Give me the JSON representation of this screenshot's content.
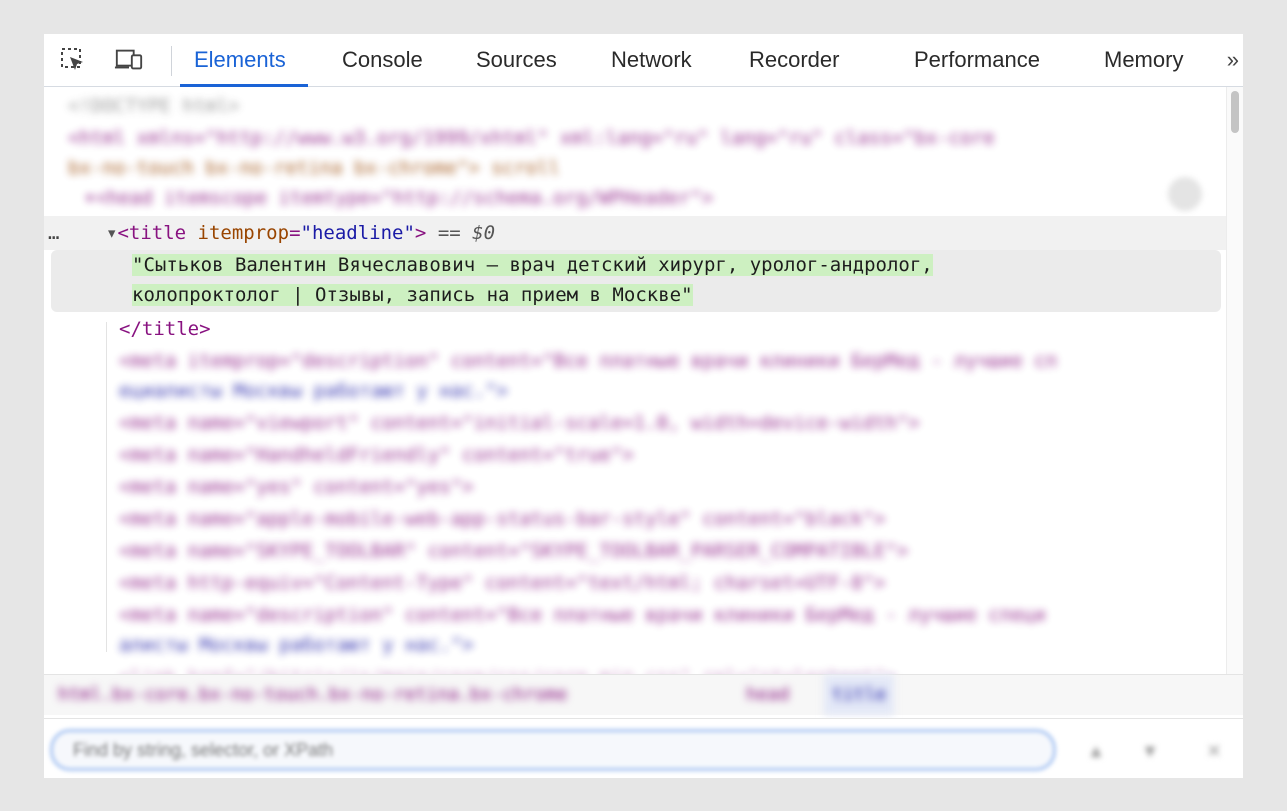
{
  "tabs": [
    {
      "label": "Elements",
      "active": true
    },
    {
      "label": "Console"
    },
    {
      "label": "Sources"
    },
    {
      "label": "Network"
    },
    {
      "label": "Recorder"
    },
    {
      "label": "Performance"
    },
    {
      "label": "Memory"
    }
  ],
  "more_tabs_glyph": "»",
  "toolbar_icons": [
    "inspect-element-icon",
    "device-toolbar-icon"
  ],
  "tree": {
    "blurred_above": [
      "<!DOCTYPE html>",
      "<html xmlns=\"http://www.w3.org/1999/xhtml\" xml:lang=\"ru\" lang=\"ru\" class=\"bx-core",
      "  bx-no-touch bx-no-retina bx-chrome\"> scroll",
      "▾<head itemscope itemtype=\"http://schema.org/WPHeader\">"
    ],
    "selected_dots": "…",
    "title_open": {
      "arrow": "▾",
      "tag_open": "<title",
      "attr_name": "itemprop",
      "eq": "=",
      "attr_value": "\"headline\"",
      "tag_close": ">",
      "console_ref": "== $0"
    },
    "title_text_line1": "\"Сытьков Валентин Вячеславович — врач детский хирург, уролог-андролог,",
    "title_text_line2": "колопроктолог | Отзывы, запись на прием в Москве\"",
    "title_close": "</title>",
    "blurred_below": [
      "<meta itemprop=\"description\" content=\"Все платные врачи клиники БерМед - лучшие сп",
      "ециалисты Москвы работают у нас.\">",
      "<meta name=\"viewport\" content=\"initial-scale=1.0, width=device-width\">",
      "<meta name=\"HandheldFriendly\" content=\"true\">",
      "<meta name=\"yes\" content=\"yes\">",
      "<meta name=\"apple-mobile-web-app-status-bar-style\" content=\"black\">",
      "<meta name=\"SKYPE_TOOLBAR\" content=\"SKYPE_TOOLBAR_PARSER_COMPATIBLE\">",
      "<meta http-equiv=\"Content-Type\" content=\"text/html; charset=UTF-8\">",
      "<meta name=\"description\" content=\"Все платные врачи клиники БерМед - лучшие специ",
      "алисты Москвы работают у нас.\">",
      "<link href=\"/bitrix/js/main/core/css/core.min.css\" rel=\"stylesheet\">"
    ]
  },
  "breadcrumbs": {
    "items": [
      "html.bx-core.bx-no-touch.bx-no-retina.bx-chrome",
      "head",
      "title"
    ]
  },
  "search": {
    "placeholder": "Find by string, selector, or XPath"
  }
}
